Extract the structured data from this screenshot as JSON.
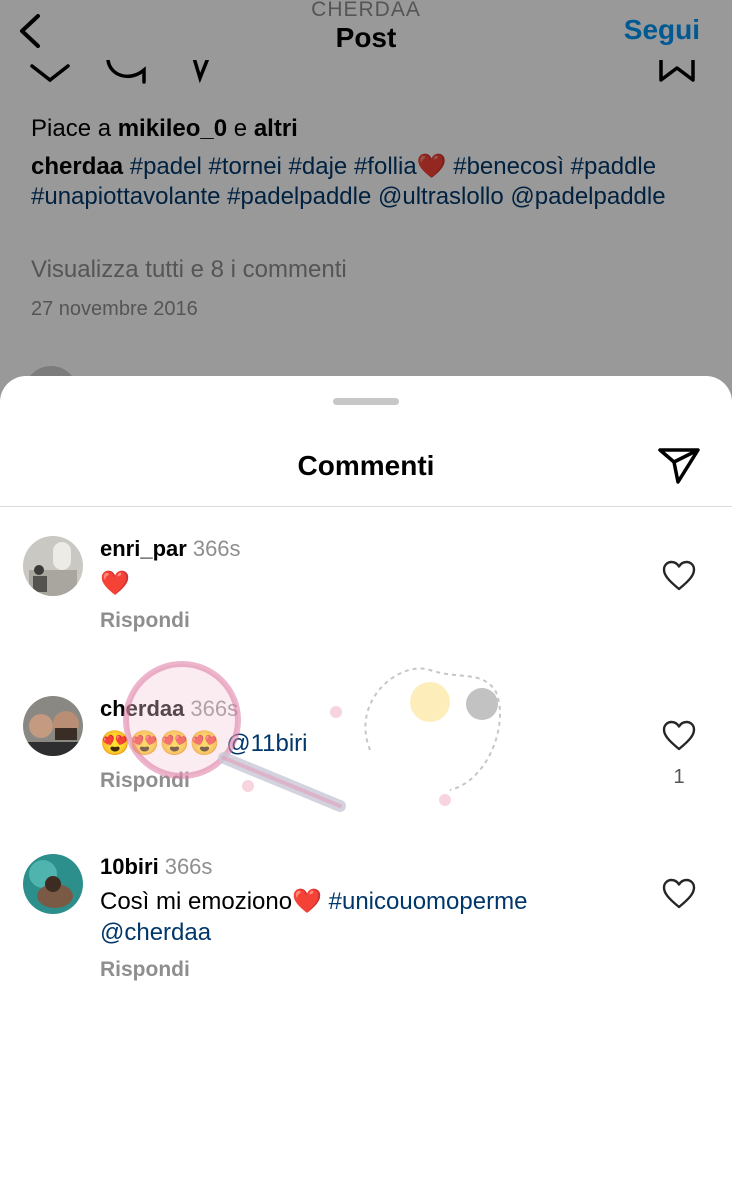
{
  "header": {
    "account": "CHERDAA",
    "title": "Post",
    "follow_label": "Segui"
  },
  "post": {
    "likes_prefix": "Piace a ",
    "likes_user": "mikileo_0",
    "likes_middle": " e ",
    "likes_suffix": "altri",
    "caption_user": "cherdaa",
    "caption_segments": [
      "#padel",
      "#tornei",
      "#daje",
      "#follia",
      "❤️",
      "#benecosì",
      "#paddle",
      "#unapiottavolante",
      "#padelpaddle",
      "@ultraslollo",
      "@padelpaddle"
    ],
    "view_all": "Visualizza tutti e 8 i commenti",
    "date": "27 novembre 2016"
  },
  "sheet": {
    "title": "Commenti"
  },
  "comments": [
    {
      "user": "enri_par",
      "time": "366s",
      "text": "❤️",
      "reply": "Rispondi",
      "likes": ""
    },
    {
      "user": "cherdaa",
      "time": "366s",
      "emojis": "😍😍😍😍",
      "mention": "@11biri",
      "reply": "Rispondi",
      "likes": "1"
    },
    {
      "user": "10biri",
      "time": "366s",
      "text": "Così mi emoziono❤️",
      "tag": "#unicouomoperme",
      "mention": "@cherdaa",
      "reply": "Rispondi",
      "likes": ""
    }
  ],
  "colors": {
    "accent": "#0095f6",
    "link": "#00376b",
    "muted": "#8e8e8e",
    "overlay": "rgba(0,0,0,0.40)"
  }
}
